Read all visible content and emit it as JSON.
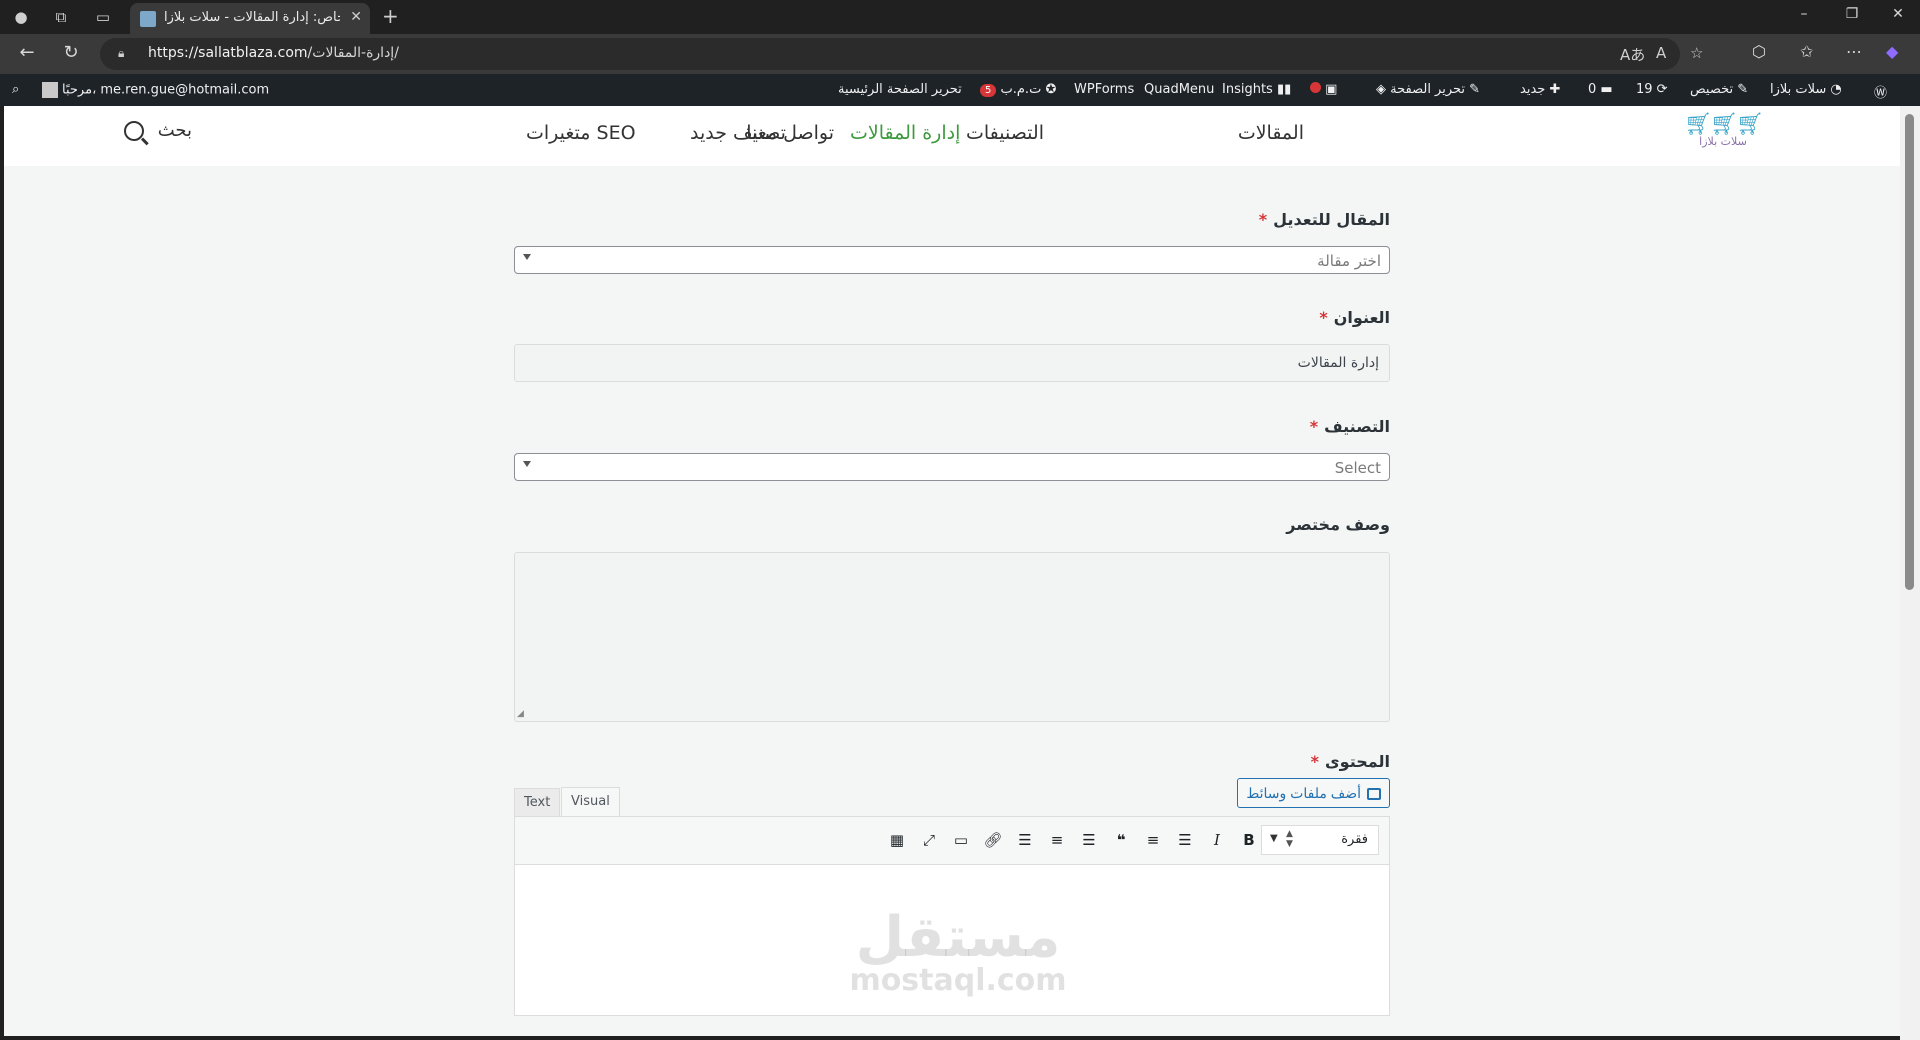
{
  "browser": {
    "tab_title": "خاص: إدارة المقالات - سلات بلازا",
    "url_host": "https://sallatblaza.com",
    "url_path": "/إدارة-المقالات/",
    "reader_aa": "Aあ",
    "read_aloud": "A",
    "new_tab": "+",
    "minimize": "–",
    "restore": "❐",
    "close": "✕"
  },
  "adminbar": {
    "site_name": "سلات بلازا",
    "customize": "تخصيص",
    "updates_count": "19",
    "comments_count": "0",
    "new": "جديد",
    "edit_page": "تحرير الصفحة",
    "insights": "Insights",
    "quadmenu": "QuadMenu",
    "wpforms": "WPForms",
    "seo": "ت.م.ب",
    "seo_badge": "5",
    "edit_home": "تحرير الصفحة الرئيسية",
    "greeting": "مرحبًا، me.ren.gue@hotmail.com"
  },
  "site": {
    "logo_text": "سلات بلازا",
    "nav": {
      "articles": "المقالات",
      "categories": "التصنيفات",
      "contact": "تواصل معنا",
      "manage": "إدارة المقالات",
      "new_category": "تصنيف جديد",
      "seo_vars": "متغيرات SEO"
    },
    "search": "بحث"
  },
  "form": {
    "post_label": "المقال للتعديل",
    "post_placeholder": "اختر مقالة",
    "title_label": "العنوان",
    "title_value": "إدارة المقالات",
    "category_label": "التصنيف",
    "category_placeholder": "Select",
    "excerpt_label": "وصف مختصر",
    "content_label": "المحتوى",
    "required_mark": "*",
    "add_media": "أضف ملفات وسائط",
    "tab_text": "Text",
    "tab_visual": "Visual",
    "format_select": "فقرة"
  },
  "watermark": {
    "line1": "مستقل",
    "line2": "mostaql.com"
  },
  "colors": {
    "nav_active": "#3d9a3d",
    "required": "#d63638",
    "wp_blue": "#2271b1",
    "adminbar_bg": "#1d2327"
  }
}
